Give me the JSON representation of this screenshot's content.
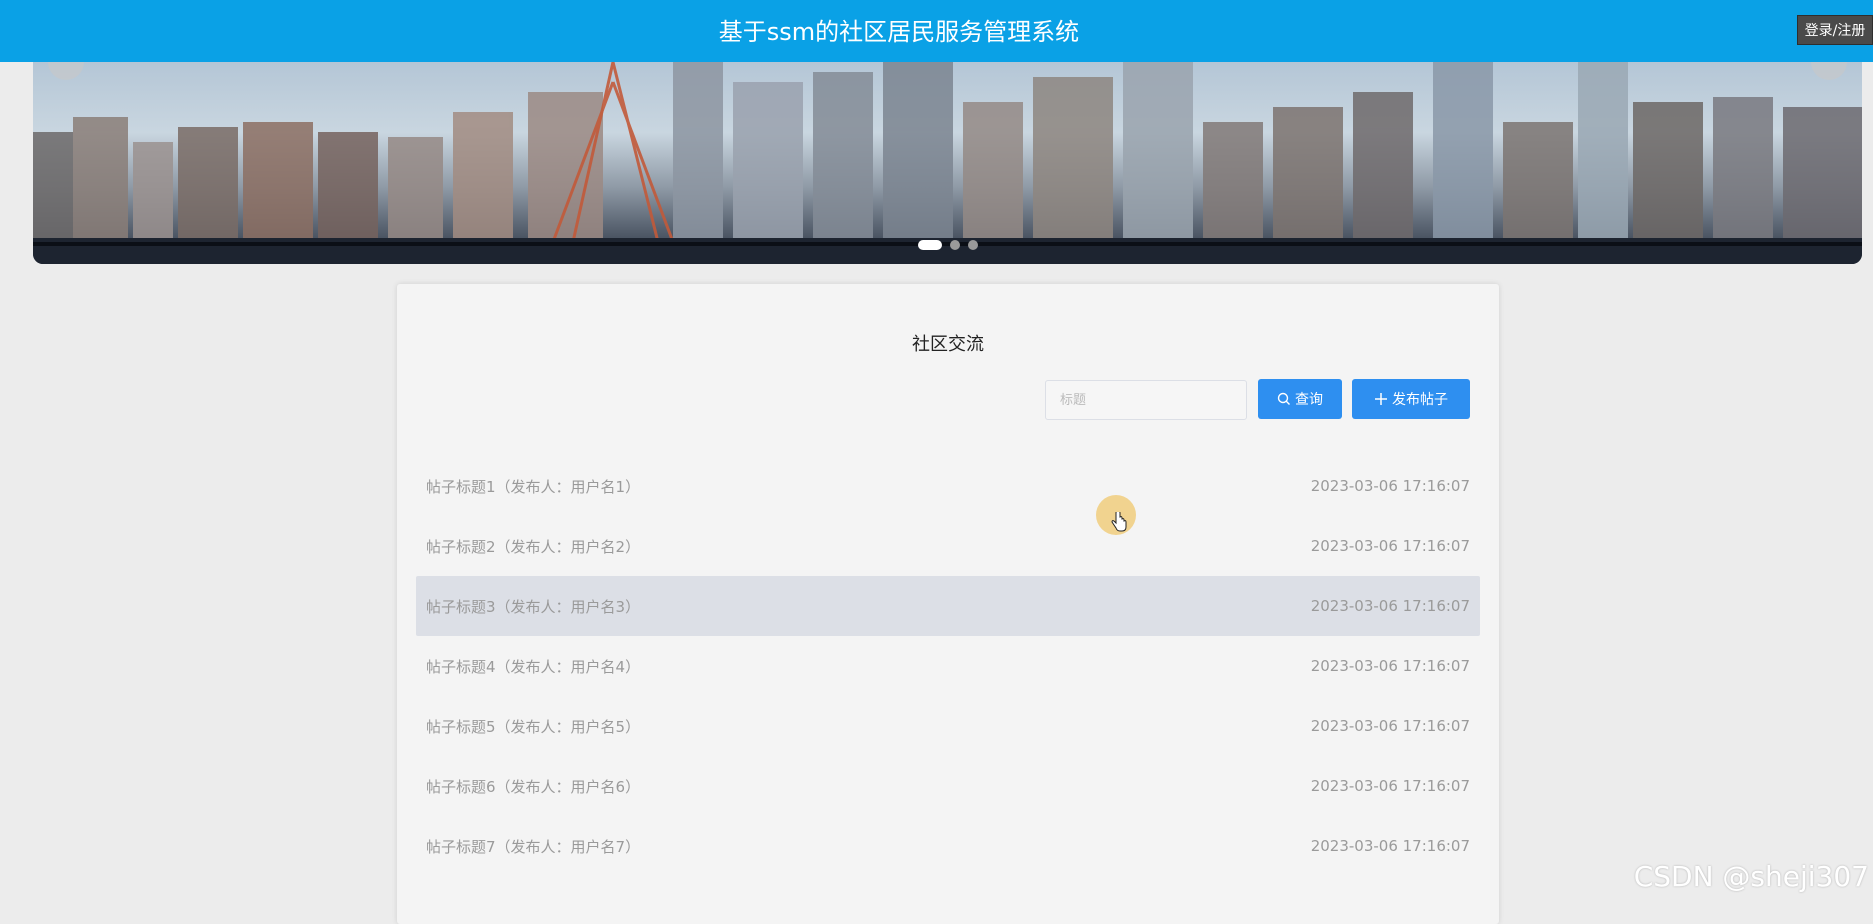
{
  "header": {
    "title": "基于ssm的社区居民服务管理系统",
    "login_label": "登录/注册",
    "accent": "#0aa1e6"
  },
  "banner": {
    "slides": 3,
    "active_slide": 1
  },
  "main": {
    "title": "社区交流",
    "search": {
      "placeholder": "标题",
      "value": ""
    },
    "query_label": "查询",
    "post_label": "发布帖子",
    "posts": [
      {
        "title": "帖子标题1（发布人：用户名1）",
        "time": "2023-03-06 17:16:07"
      },
      {
        "title": "帖子标题2（发布人：用户名2）",
        "time": "2023-03-06 17:16:07"
      },
      {
        "title": "帖子标题3（发布人：用户名3）",
        "time": "2023-03-06 17:16:07"
      },
      {
        "title": "帖子标题4（发布人：用户名4）",
        "time": "2023-03-06 17:16:07"
      },
      {
        "title": "帖子标题5（发布人：用户名5）",
        "time": "2023-03-06 17:16:07"
      },
      {
        "title": "帖子标题6（发布人：用户名6）",
        "time": "2023-03-06 17:16:07"
      },
      {
        "title": "帖子标题7（发布人：用户名7）",
        "time": "2023-03-06 17:16:07"
      }
    ],
    "hovered_index": 2
  },
  "watermark": "CSDN @sheji307",
  "icons": {
    "query": "search-icon",
    "post": "plus-icon",
    "cursor": "hand-pointer-icon"
  }
}
